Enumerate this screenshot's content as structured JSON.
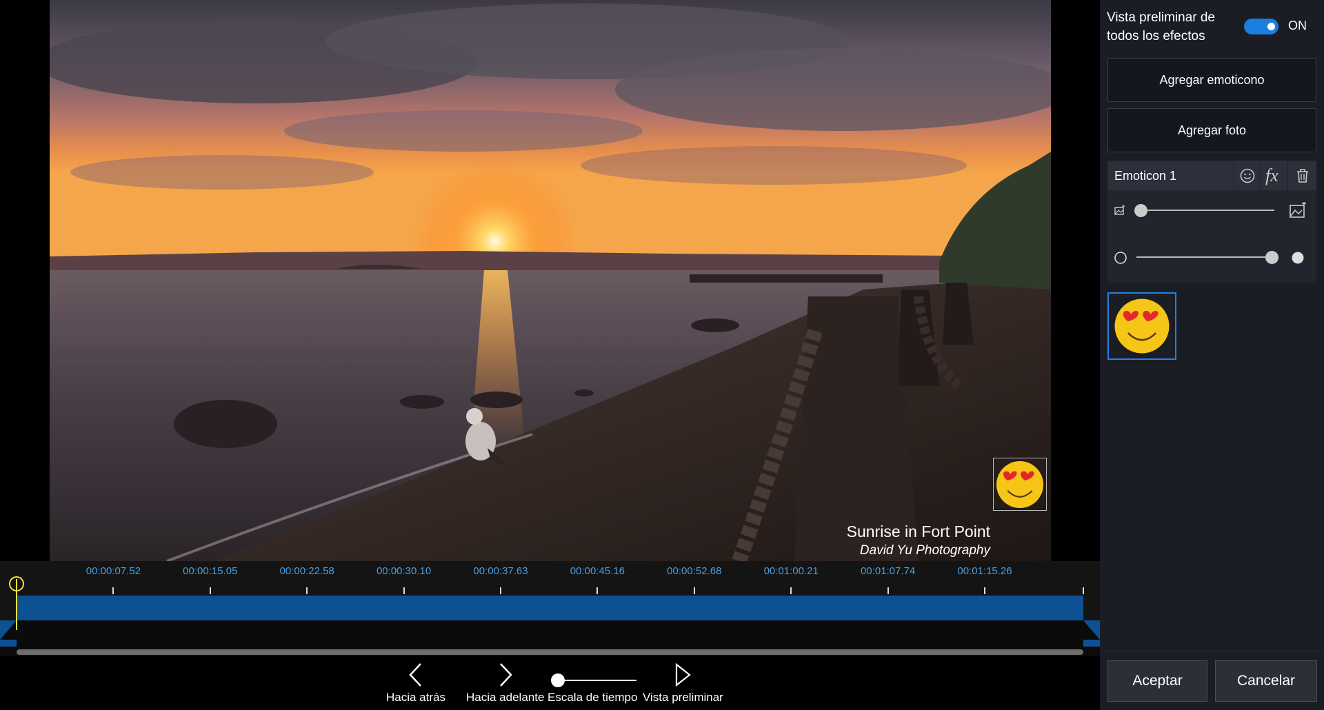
{
  "video": {
    "watermark_title": "Sunrise in Fort Point",
    "watermark_subtitle": "David Yu Photography"
  },
  "timeline": {
    "ticks": [
      "00:00:07.52",
      "00:00:15.05",
      "00:00:22.58",
      "00:00:30.10",
      "00:00:37.63",
      "00:00:45.16",
      "00:00:52.68",
      "00:01:00.21",
      "00:01:07.74",
      "00:01:15.26"
    ],
    "playhead_color": "#f3e23a",
    "track_color": "#0e5193",
    "tick_color": "#4a9fe0"
  },
  "controls": {
    "back_label": "Hacia atrás",
    "forward_label": "Hacia adelante",
    "zoom_label": "Escala de tiempo",
    "preview_label": "Vista preliminar"
  },
  "panel": {
    "preview_all_label": "Vista preliminar de todos los efectos",
    "preview_all_state": "ON",
    "add_emoji_label": "Agregar emoticono",
    "add_photo_label": "Agregar foto",
    "item_name": "Emoticon 1",
    "item_icons": [
      "emoji-icon",
      "fx-icon",
      "trash-icon"
    ],
    "size_slider_value": 0.03,
    "opacity_slider_value": 0.98,
    "accept_label": "Aceptar",
    "cancel_label": "Cancelar",
    "accent_color": "#1a7fe0"
  }
}
